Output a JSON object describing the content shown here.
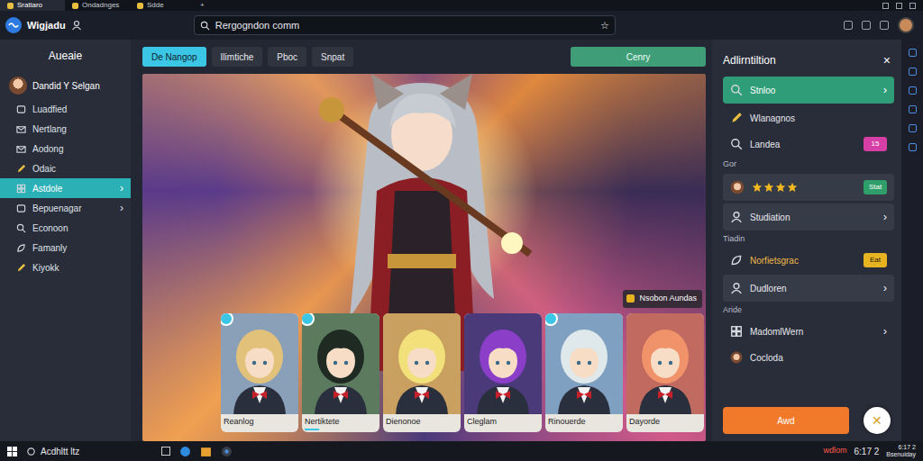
{
  "browser": {
    "tabs": [
      {
        "label": "Sratiaro",
        "selected": true
      },
      {
        "label": "Ondadnges",
        "selected": false
      },
      {
        "label": "Sdde",
        "selected": false
      }
    ],
    "new_tab": "+",
    "app_name": "Wigjadu",
    "address": "Rergogndon comm",
    "star": "☆"
  },
  "sidebar": {
    "title": "Aueaie",
    "user": "Dandid Y Selgan",
    "items": [
      {
        "label": "Luadfied",
        "selected": false
      },
      {
        "label": "Nertlang",
        "selected": false
      },
      {
        "label": "Aodong",
        "selected": false
      },
      {
        "label": "Odaic",
        "selected": false
      },
      {
        "label": "Astdole",
        "selected": true,
        "arrow": "›"
      },
      {
        "label": "Bepuenagar",
        "selected": false,
        "arrow": "›"
      },
      {
        "label": "Econoon",
        "selected": false
      },
      {
        "label": "Famanly",
        "selected": false
      },
      {
        "label": "Kiyokk",
        "selected": false
      }
    ]
  },
  "main": {
    "tabs": [
      {
        "label": "De Nangop",
        "selected": true
      },
      {
        "label": "Ilimtiche",
        "selected": false
      },
      {
        "label": "Pboc",
        "selected": false
      },
      {
        "label": "Snpat",
        "selected": false
      }
    ],
    "action": "Cenry",
    "hero_badge": "Nsobon Aundas",
    "characters": [
      {
        "name": "Reanlog",
        "color": "#e2c27a",
        "pinned": true,
        "selected": false
      },
      {
        "name": "Nertiktete",
        "color": "#1e2a22",
        "pinned": true,
        "selected": true
      },
      {
        "name": "Dienonoe",
        "color": "#f2e07a",
        "pinned": false,
        "selected": false
      },
      {
        "name": "Cleglam",
        "color": "#8b3fc9",
        "pinned": false,
        "selected": false
      },
      {
        "name": "Rinouerde",
        "color": "#dfe8ea",
        "pinned": true,
        "selected": false
      },
      {
        "name": "Dayorde",
        "color": "#f0926a",
        "pinned": false,
        "selected": false
      }
    ]
  },
  "panel": {
    "title": "Adlirntiltion",
    "close": "×",
    "items": [
      {
        "kind": "box",
        "label": "Stnloo",
        "selected": true,
        "arrow": "›"
      },
      {
        "kind": "item",
        "label": "Wlanagnos",
        "selected": false
      },
      {
        "kind": "item",
        "label": "Landea",
        "selected": false,
        "badge": "15",
        "color": "#d63fa6"
      },
      {
        "kind": "heading",
        "label": "Gor"
      },
      {
        "kind": "rating",
        "stars": 4,
        "badge": "Stat",
        "color": "#2f9e6a"
      },
      {
        "kind": "box",
        "label": "Studiation",
        "selected": false,
        "arrow": "›"
      },
      {
        "kind": "heading",
        "label": "Tiadin"
      },
      {
        "kind": "item",
        "label": "Norfietsgrac",
        "selected": false,
        "badge": "Eat",
        "color": "#e8b320"
      },
      {
        "kind": "box",
        "label": "Dudloren",
        "selected": false,
        "arrow": "›"
      },
      {
        "kind": "heading",
        "label": "Aride"
      },
      {
        "kind": "item",
        "label": "MadomlWern",
        "selected": false,
        "arrow": "›"
      },
      {
        "kind": "item",
        "label": "Cocloda",
        "selected": false
      }
    ],
    "button": "Awd",
    "fab": "✕"
  },
  "taskbar": {
    "search": "Acdhltt ltz",
    "tray_label": "wdlom",
    "time": "6:17 2",
    "clock_time": "6:17 2",
    "clock_date": "Bsenuiday"
  }
}
